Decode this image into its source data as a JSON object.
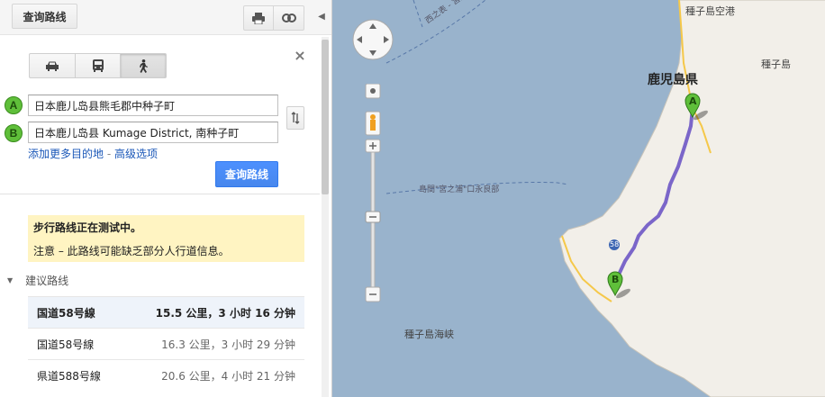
{
  "toolbar": {
    "get_directions_label": "查询路线",
    "print_icon": "print-icon",
    "link_icon": "link-icon",
    "collapse_icon": "collapse-left-icon"
  },
  "travel_modes": [
    {
      "name": "car",
      "icon": "car-icon",
      "active": false
    },
    {
      "name": "transit",
      "icon": "bus-icon",
      "active": false
    },
    {
      "name": "walking",
      "icon": "walking-icon",
      "active": true
    }
  ],
  "waypoints": {
    "a": {
      "marker": "A",
      "value": "日本鹿儿岛县熊毛郡中种子町"
    },
    "b": {
      "marker": "B",
      "value": "日本鹿儿岛县 Kumage District, 南种子町"
    }
  },
  "links": {
    "add_destination": "添加更多目的地",
    "separator": " - ",
    "advanced_options": "高级选项"
  },
  "get_directions_button": "查询路线",
  "notice": {
    "title": "步行路线正在测试中。",
    "body": "注意 – 此路线可能缺乏部分人行道信息。"
  },
  "suggested_routes": {
    "header": "建议路线",
    "routes": [
      {
        "name": "国道58号線",
        "info": "15.5 公里，3 小时 16 分钟",
        "selected": true
      },
      {
        "name": "国道58号線",
        "info": "16.3 公里，3 小时 29 分钟",
        "selected": false
      },
      {
        "name": "県道588号線",
        "info": "20.6 公里，4 小时 21 分钟",
        "selected": false
      }
    ]
  },
  "map": {
    "labels": {
      "airport": "種子島空港",
      "island": "種子島",
      "prefecture": "鹿児島県",
      "sea_north": "西之表 - 宮之浦",
      "sea_mid": "島間\"宮之浦\"口永良部",
      "strait": "種子島海峡",
      "route_number": "58"
    },
    "markers": {
      "a": "A",
      "b": "B"
    },
    "colors": {
      "sea": "#99b3cc",
      "land": "#f2efe9",
      "route": "#7b66c9",
      "marker": "#5fbf3a"
    }
  }
}
